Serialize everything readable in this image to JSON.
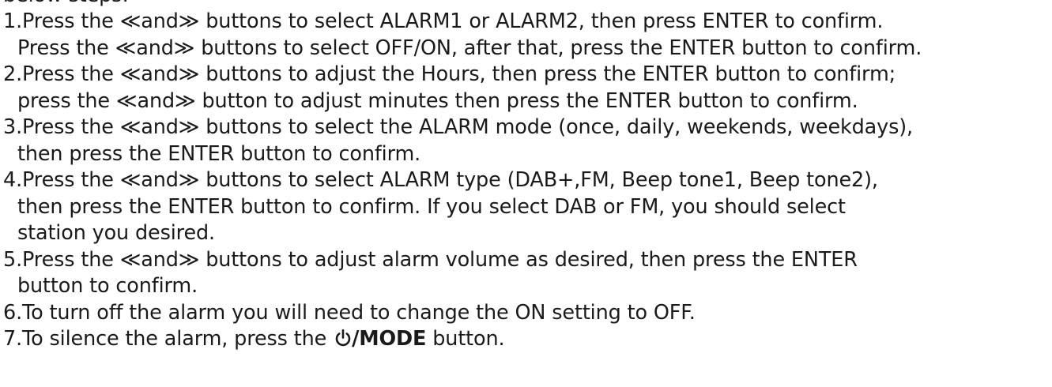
{
  "intro_fragment": "below steps:",
  "steps": [
    {
      "number": "1.",
      "lines": [
        "Press the ≪and≫ buttons to select ALARM1 or ALARM2, then press ENTER to confirm.",
        "Press the ≪and≫ buttons to select OFF/ON, after that, press the ENTER button to confirm."
      ]
    },
    {
      "number": "2.",
      "lines": [
        "Press the ≪and≫ buttons to adjust the Hours, then press the ENTER button to confirm;",
        "press the ≪and≫ button to  adjust minutes then press the ENTER button to confirm."
      ]
    },
    {
      "number": "3.",
      "lines": [
        "Press the ≪and≫ buttons to select the ALARM mode (once, daily, weekends, weekdays),",
        "then press the ENTER button to confirm."
      ]
    },
    {
      "number": "4.",
      "lines": [
        "Press the ≪and≫ buttons to select ALARM type (DAB+,FM, Beep tone1, Beep tone2),",
        "then press the ENTER button to confirm. If you select DAB or FM, you should select",
        "station you desired."
      ]
    },
    {
      "number": "5.",
      "lines": [
        "Press the ≪and≫ buttons to adjust alarm volume as desired, then press the ENTER",
        "button to confirm."
      ]
    },
    {
      "number": "6.",
      "lines": [
        "To turn off the alarm you will need to change the ON setting to OFF."
      ]
    }
  ],
  "final_step": {
    "number": "7.",
    "text_before": "To silence the alarm, press the ",
    "icon": "power-icon",
    "mode_label": "/MODE",
    "text_after": " button."
  },
  "colors": {
    "text": "#1a1a1a",
    "background": "#ffffff"
  }
}
